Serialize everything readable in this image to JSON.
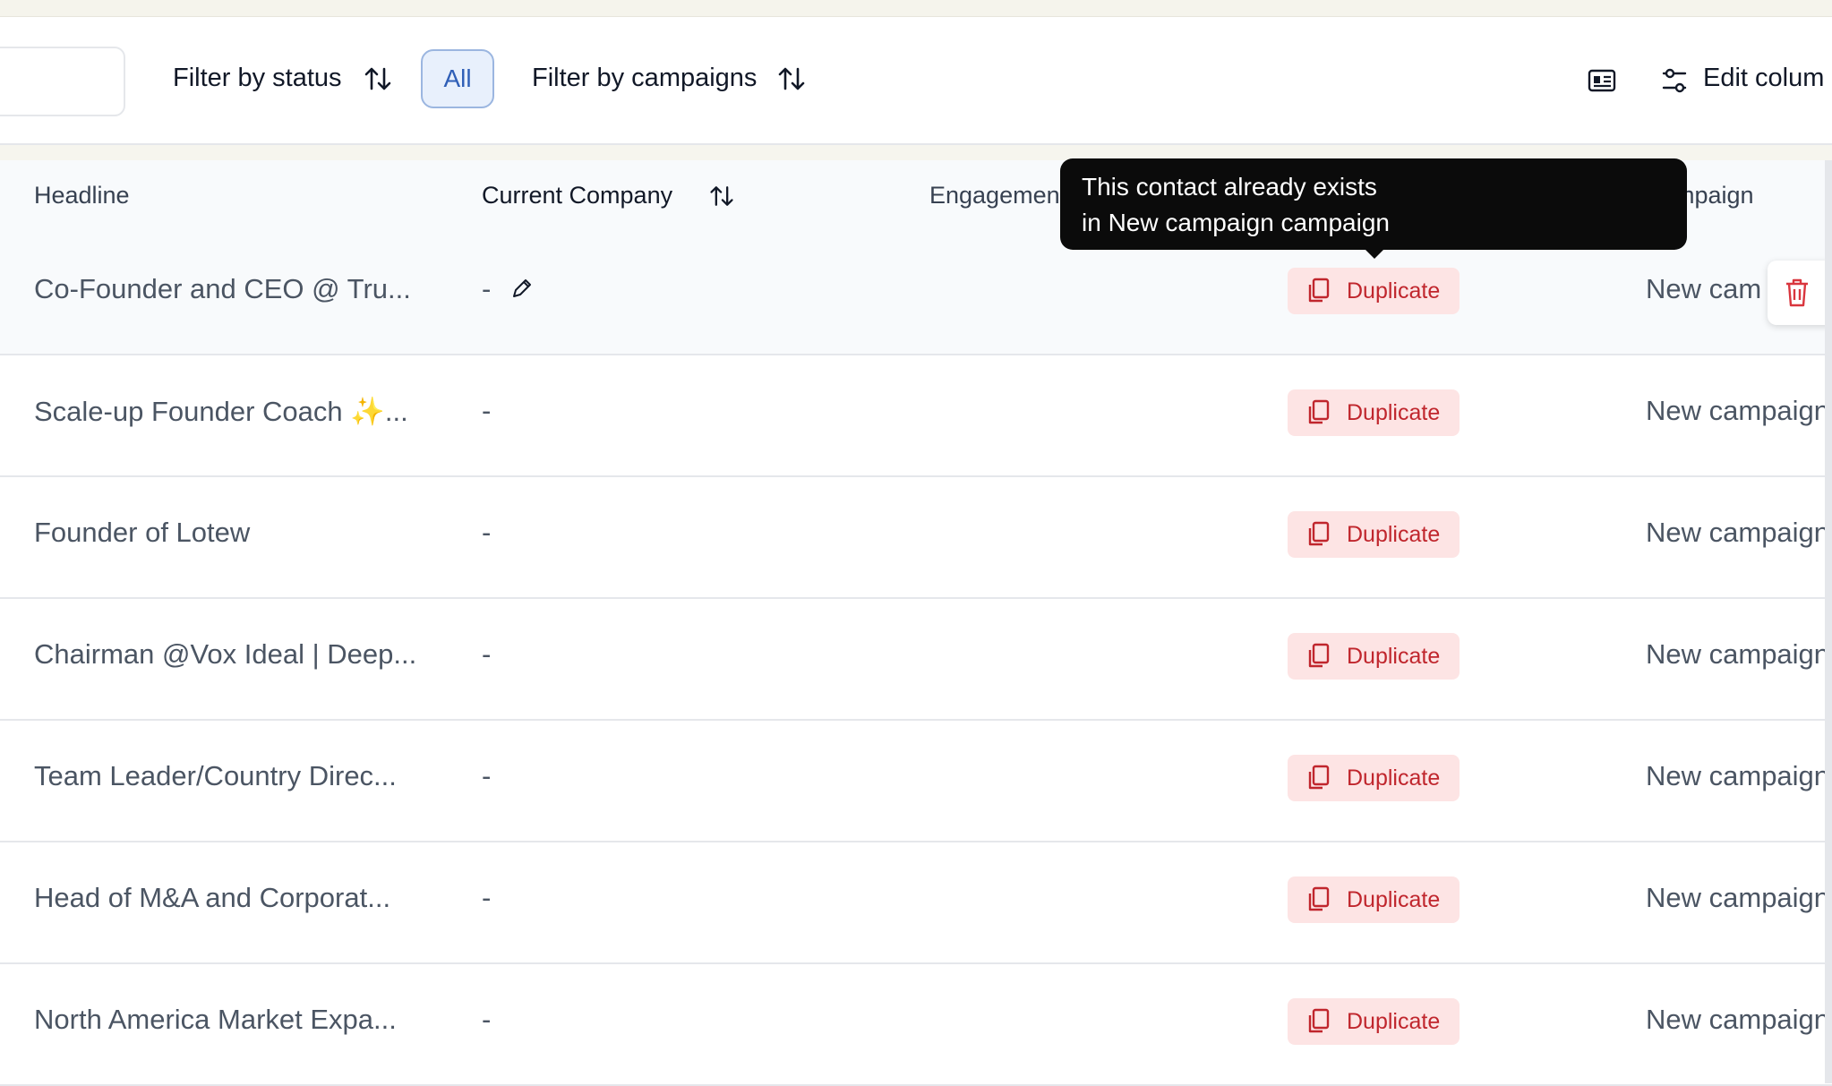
{
  "toolbar": {
    "filter_status_label": "Filter by status",
    "all_chip": "All",
    "filter_campaigns_label": "Filter by campaigns",
    "edit_columns_label": "Edit colum"
  },
  "table": {
    "headers": {
      "headline": "Headline",
      "company": "Current Company",
      "engagement": "Engagemen",
      "campaign": "mpaign"
    },
    "rows": [
      {
        "headline": "Co-Founder and CEO @ Tru...",
        "company": "-",
        "status": "Duplicate",
        "campaign": "New cam"
      },
      {
        "headline": "Scale-up Founder Coach ✨...",
        "company": "-",
        "status": "Duplicate",
        "campaign": "New campaign"
      },
      {
        "headline": "Founder of Lotew",
        "company": "-",
        "status": "Duplicate",
        "campaign": "New campaign"
      },
      {
        "headline": "Chairman @Vox Ideal | Deep...",
        "company": "-",
        "status": "Duplicate",
        "campaign": "New campaign"
      },
      {
        "headline": "Team Leader/Country Direc...",
        "company": "-",
        "status": "Duplicate",
        "campaign": "New campaign"
      },
      {
        "headline": "Head of M&A and Corporat...",
        "company": "-",
        "status": "Duplicate",
        "campaign": "New campaign"
      },
      {
        "headline": "North America Market Expa...",
        "company": "-",
        "status": "Duplicate",
        "campaign": "New campaign"
      }
    ]
  },
  "tooltip": {
    "line1": "This contact already exists",
    "line2": "in New campaign campaign"
  },
  "colors": {
    "duplicate_bg": "#fde4e4",
    "duplicate_text": "#c0262d",
    "chip_border": "#9bb6e0",
    "chip_text": "#2f5fb7"
  },
  "icons": [
    "sort-icon",
    "id-card-icon",
    "sliders-icon",
    "pencil-icon",
    "copy-icon",
    "trash-icon"
  ]
}
